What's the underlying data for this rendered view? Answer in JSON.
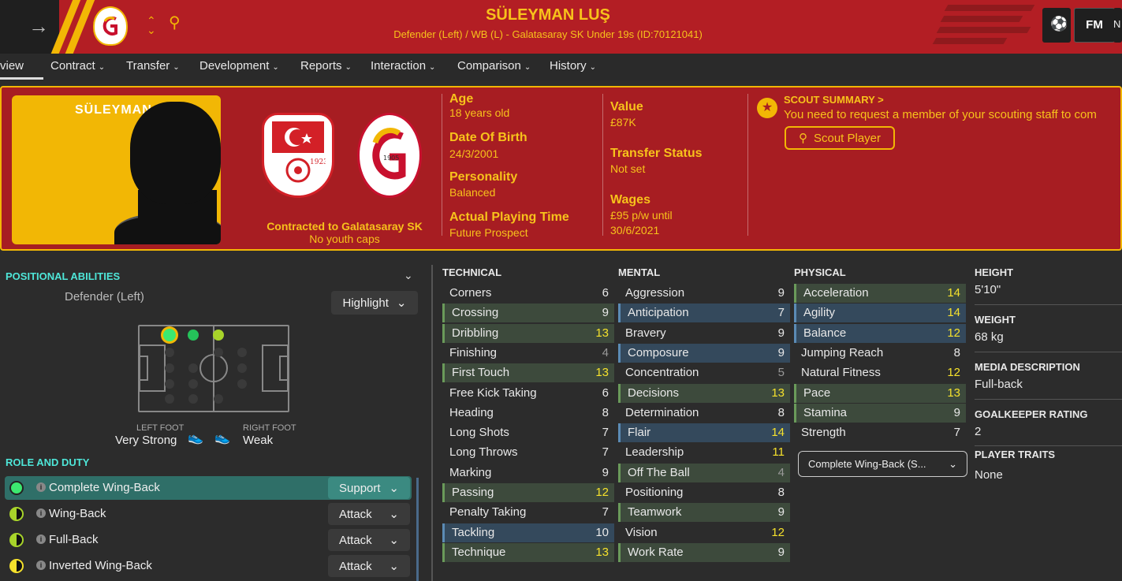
{
  "header": {
    "name": "SÜLEYMAN LUŞ",
    "subtitle": "Defender (Left) / WB (L) - Galatasaray SK Under 19s (ID:70121041)",
    "fm_label": "FM",
    "right_partial": "N"
  },
  "nav": [
    {
      "label": "view",
      "active": true
    },
    {
      "label": "Contract"
    },
    {
      "label": "Transfer"
    },
    {
      "label": "Development"
    },
    {
      "label": "Reports"
    },
    {
      "label": "Interaction"
    },
    {
      "label": "Comparison"
    },
    {
      "label": "History"
    }
  ],
  "profile": {
    "photo_name": "SÜLEYMAN",
    "nation_badge_year": "1923",
    "club_badge_year": "1905",
    "contracted": "Contracted to Galatasaray SK",
    "caps": "No youth caps",
    "age_label": "Age",
    "age": "18 years old",
    "dob_label": "Date Of Birth",
    "dob": "24/3/2001",
    "personality_label": "Personality",
    "personality": "Balanced",
    "apt_label": "Actual Playing Time",
    "apt": "Future Prospect",
    "value_label": "Value",
    "value": "£87K",
    "transfer_label": "Transfer Status",
    "transfer": "Not set",
    "wages_label": "Wages",
    "wages_1": "£95 p/w until",
    "wages_2": "30/6/2021"
  },
  "scout": {
    "title": "SCOUT SUMMARY >",
    "text": "You need to request a member of your scouting staff to com",
    "button": "Scout Player"
  },
  "positional": {
    "title": "POSITIONAL ABILITIES",
    "role": "Defender (Left)",
    "highlight": "Highlight",
    "left_foot_label": "LEFT FOOT",
    "left_foot": "Very Strong",
    "right_foot_label": "RIGHT FOOT",
    "right_foot": "Weak"
  },
  "roles": {
    "title": "ROLE AND DUTY",
    "items": [
      {
        "name": "Complete Wing-Back",
        "duty": "Support"
      },
      {
        "name": "Wing-Back",
        "duty": "Attack"
      },
      {
        "name": "Full-Back",
        "duty": "Attack"
      },
      {
        "name": "Inverted Wing-Back",
        "duty": "Attack"
      }
    ]
  },
  "technical": {
    "title": "TECHNICAL",
    "items": [
      {
        "name": "Corners",
        "value": "6"
      },
      {
        "name": "Crossing",
        "value": "9"
      },
      {
        "name": "Dribbling",
        "value": "13"
      },
      {
        "name": "Finishing",
        "value": "4"
      },
      {
        "name": "First Touch",
        "value": "13"
      },
      {
        "name": "Free Kick Taking",
        "value": "6"
      },
      {
        "name": "Heading",
        "value": "8"
      },
      {
        "name": "Long Shots",
        "value": "7"
      },
      {
        "name": "Long Throws",
        "value": "7"
      },
      {
        "name": "Marking",
        "value": "9"
      },
      {
        "name": "Passing",
        "value": "12"
      },
      {
        "name": "Penalty Taking",
        "value": "7"
      },
      {
        "name": "Tackling",
        "value": "10"
      },
      {
        "name": "Technique",
        "value": "13"
      }
    ]
  },
  "mental": {
    "title": "MENTAL",
    "items": [
      {
        "name": "Aggression",
        "value": "9"
      },
      {
        "name": "Anticipation",
        "value": "7"
      },
      {
        "name": "Bravery",
        "value": "9"
      },
      {
        "name": "Composure",
        "value": "9"
      },
      {
        "name": "Concentration",
        "value": "5"
      },
      {
        "name": "Decisions",
        "value": "13"
      },
      {
        "name": "Determination",
        "value": "8"
      },
      {
        "name": "Flair",
        "value": "14"
      },
      {
        "name": "Leadership",
        "value": "11"
      },
      {
        "name": "Off The Ball",
        "value": "4"
      },
      {
        "name": "Positioning",
        "value": "8"
      },
      {
        "name": "Teamwork",
        "value": "9"
      },
      {
        "name": "Vision",
        "value": "12"
      },
      {
        "name": "Work Rate",
        "value": "9"
      }
    ]
  },
  "physical": {
    "title": "PHYSICAL",
    "items": [
      {
        "name": "Acceleration",
        "value": "14"
      },
      {
        "name": "Agility",
        "value": "14"
      },
      {
        "name": "Balance",
        "value": "12"
      },
      {
        "name": "Jumping Reach",
        "value": "8"
      },
      {
        "name": "Natural Fitness",
        "value": "12"
      },
      {
        "name": "Pace",
        "value": "13"
      },
      {
        "name": "Stamina",
        "value": "9"
      },
      {
        "name": "Strength",
        "value": "7"
      }
    ],
    "role_select": "Complete Wing-Back (S..."
  },
  "side": {
    "height_label": "HEIGHT",
    "height": "5'10\"",
    "weight_label": "WEIGHT",
    "weight": "68 kg",
    "media_label": "MEDIA DESCRIPTION",
    "media": "Full-back",
    "gk_label": "GOALKEEPER RATING",
    "gk": "2",
    "traits_label": "PLAYER TRAITS",
    "traits": "None"
  },
  "colors": {
    "header_red": "#b31e24",
    "panel_red": "#a71d22",
    "gold": "#f2b705",
    "text_gold": "#f7c21b",
    "teal": "#4ee6d8",
    "highlight_yellow": "#f5e12c"
  }
}
